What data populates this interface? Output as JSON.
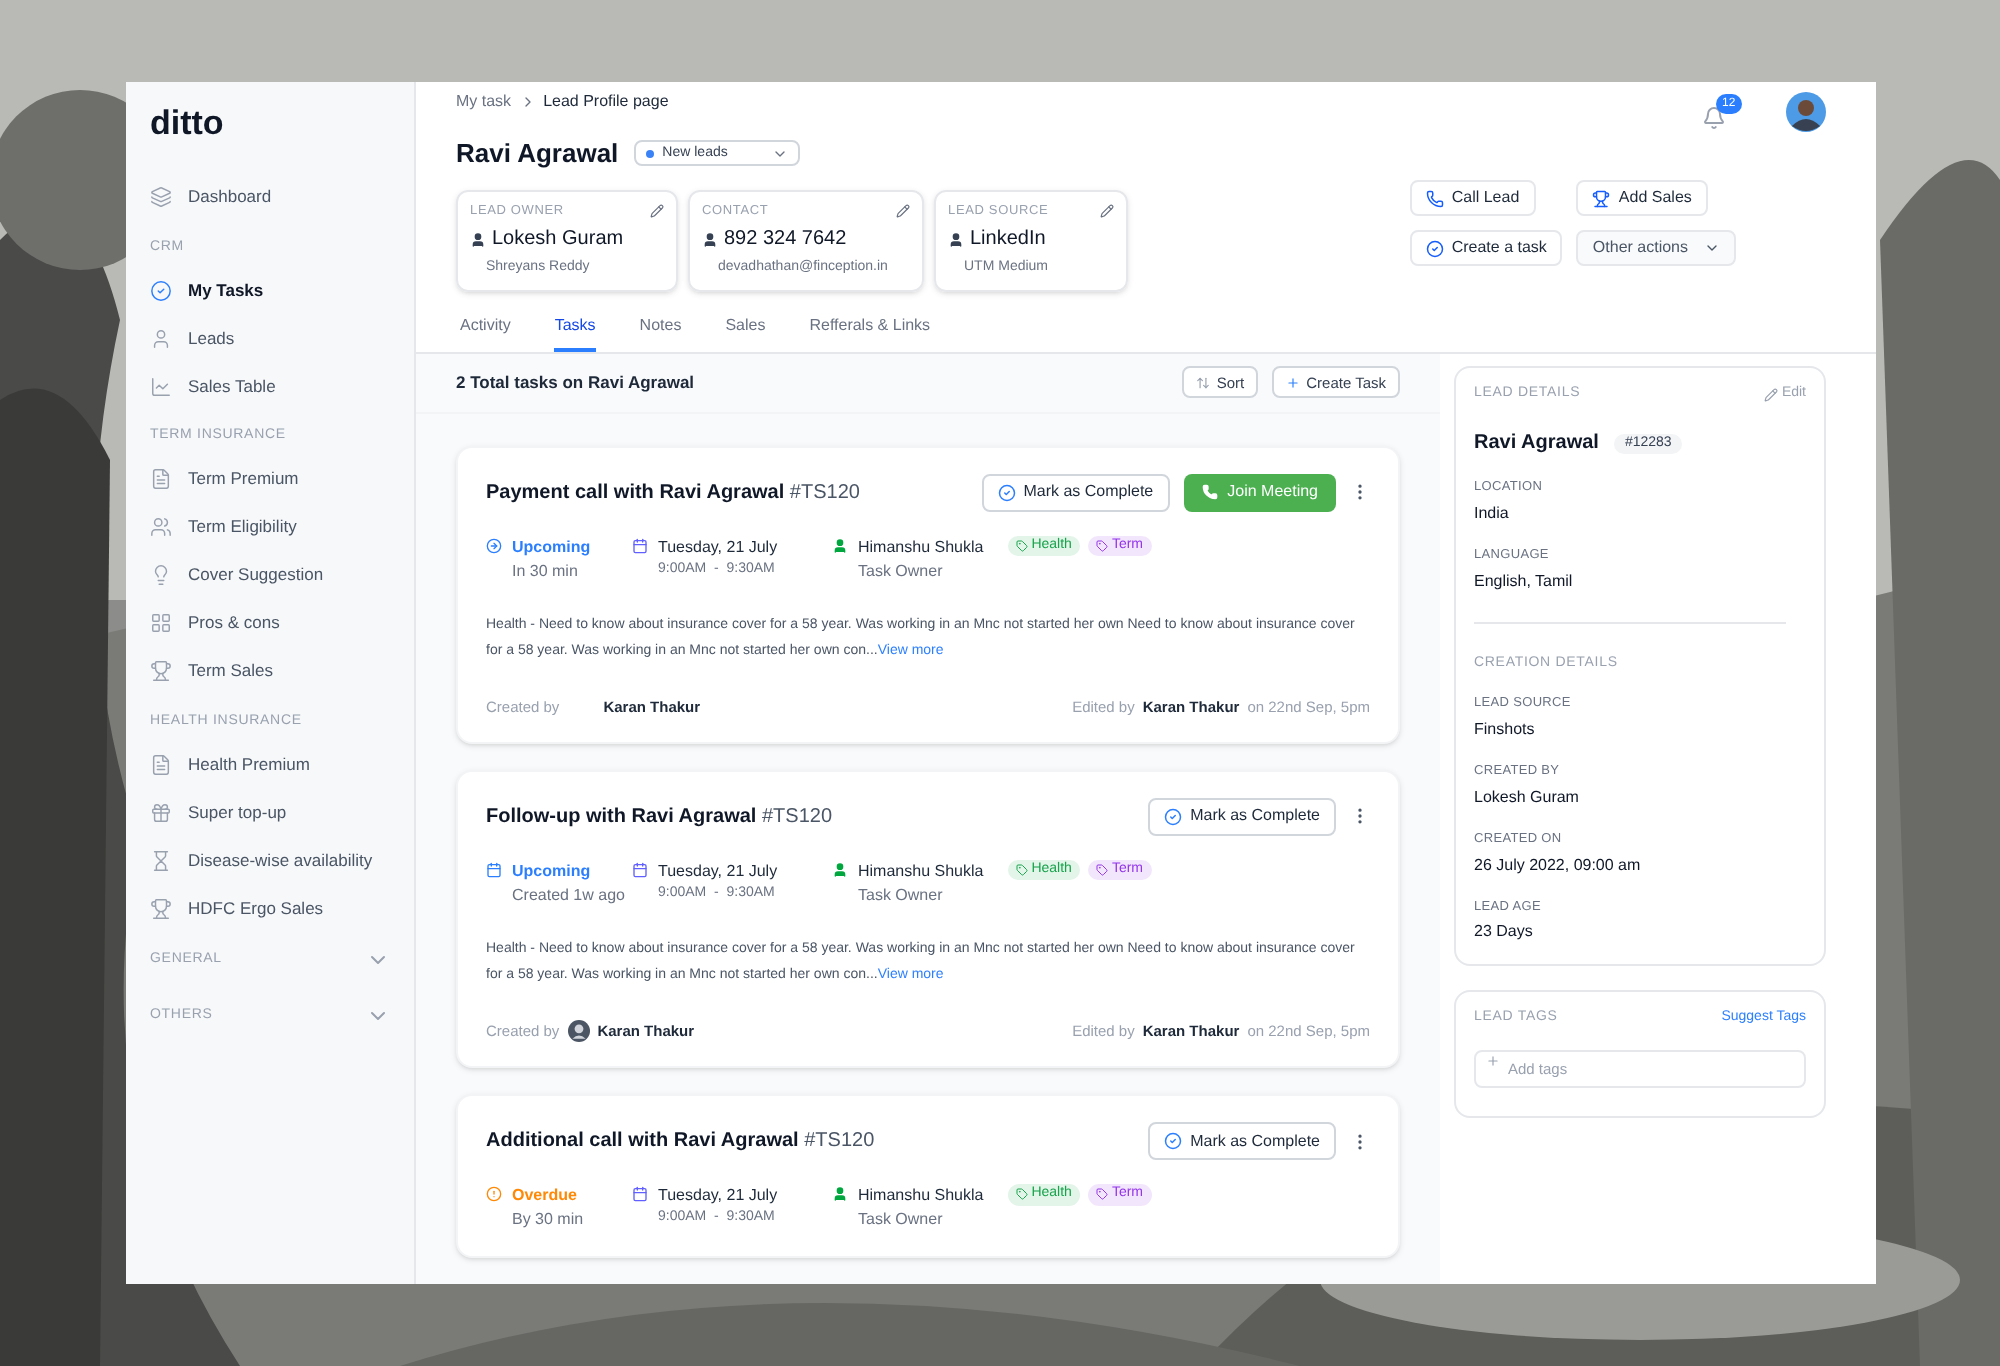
{
  "sidebar": {
    "logo": "ditto",
    "items": [
      {
        "kind": "item",
        "label": "Dashboard",
        "selected": false
      },
      {
        "kind": "section",
        "label": "CRM"
      },
      {
        "kind": "item",
        "label": "My Tasks",
        "selected": true
      },
      {
        "kind": "item",
        "label": "Leads",
        "selected": false
      },
      {
        "kind": "item",
        "label": "Sales Table",
        "selected": false
      },
      {
        "kind": "section",
        "label": "TERM INSURANCE"
      },
      {
        "kind": "item",
        "label": "Term Premium",
        "selected": false
      },
      {
        "kind": "item",
        "label": "Term Eligibility",
        "selected": false
      },
      {
        "kind": "item",
        "label": "Cover Suggestion",
        "selected": false
      },
      {
        "kind": "item",
        "label": "Pros & cons",
        "selected": false
      },
      {
        "kind": "item",
        "label": "Term Sales",
        "selected": false
      },
      {
        "kind": "section",
        "label": "HEALTH INSURANCE"
      },
      {
        "kind": "item",
        "label": "Health Premium",
        "selected": false
      },
      {
        "kind": "item",
        "label": "Super top-up",
        "selected": false
      },
      {
        "kind": "item",
        "label": "Disease-wise availability",
        "selected": false
      },
      {
        "kind": "item",
        "label": "HDFC Ergo Sales",
        "selected": false
      },
      {
        "kind": "group",
        "label": "GENERAL",
        "expanded": false
      },
      {
        "kind": "group",
        "label": "OTHERS",
        "expanded": false
      }
    ]
  },
  "breadcrumb": [
    "My task",
    "Lead Profile page"
  ],
  "notifications": {
    "count": "12"
  },
  "lead": {
    "name": "Ravi Agrawal",
    "status": {
      "label": "New leads",
      "color": "#3b82f6"
    }
  },
  "info_cards": [
    {
      "label": "LEAD OWNER",
      "value": "Lokesh Guram",
      "sub": "Shreyans Reddy"
    },
    {
      "label": "CONTACT",
      "value": "892 324 7642",
      "sub": "devadhathan@finception.in"
    },
    {
      "label": "LEAD SOURCE",
      "value": "LinkedIn",
      "sub": "UTM Medium"
    }
  ],
  "actions": [
    {
      "kind": "call",
      "label": "Call Lead"
    },
    {
      "kind": "sales",
      "label": "Add Sales"
    },
    {
      "kind": "task",
      "label": "Create a task"
    },
    {
      "kind": "menu",
      "label": "Other actions"
    }
  ],
  "tabs": [
    {
      "label": "Activity",
      "selected": false
    },
    {
      "label": "Tasks",
      "selected": true
    },
    {
      "label": "Notes",
      "selected": false
    },
    {
      "label": "Sales",
      "selected": false
    },
    {
      "label": "Refferals & Links",
      "selected": false
    }
  ],
  "tasks_header": {
    "title": "2 Total tasks on Ravi Agrawal",
    "sort": "Sort",
    "create": "Create Task"
  },
  "tasks": [
    {
      "title": "Payment call with Ravi Agrawal",
      "code": "#TS120",
      "complete": "Mark as Complete",
      "join": "Join Meeting",
      "status": {
        "kind": "upcoming",
        "label": "Upcoming",
        "sub": "In 30 min"
      },
      "date": "Tuesday, 21 July",
      "time": "9:00AM  -  9:30AM",
      "owner": "Himanshu Shukla",
      "owner_role": "Task Owner",
      "tags": [
        {
          "label": "Health",
          "color": "#16a34a"
        },
        {
          "label": "Term",
          "color": "#9333ea"
        }
      ],
      "description": "Health - Need to know about insurance cover for a 58 year. Was working in an Mnc not started her own Need to know about insurance cover for a 58 year. Was working in an Mnc not started her own con...",
      "view_more": "View more",
      "created_label": "Created by",
      "created_by": "Karan Thakur",
      "created_avatar": false,
      "edited_label": "Edited by",
      "edited_by": "Karan Thakur",
      "edited_on": "on 22nd Sep, 5pm"
    },
    {
      "title": "Follow-up  with Ravi Agrawal",
      "code": "#TS120",
      "complete": "Mark as Complete",
      "status": {
        "kind": "scheduled",
        "label": "Upcoming",
        "sub": "Created 1w ago"
      },
      "date": "Tuesday, 21 July",
      "time": "9:00AM  -  9:30AM",
      "owner": "Himanshu Shukla",
      "owner_role": "Task Owner",
      "tags": [
        {
          "label": "Health",
          "color": "#16a34a"
        },
        {
          "label": "Term",
          "color": "#9333ea"
        }
      ],
      "description": "Health - Need to know about insurance cover for a 58 year. Was working in an Mnc not started her own Need to know about insurance cover for a 58 year. Was working in an Mnc not started her own con...",
      "view_more": "View more",
      "created_label": "Created by",
      "created_by": "Karan Thakur",
      "created_avatar": true,
      "edited_label": "Edited by",
      "edited_by": "Karan Thakur",
      "edited_on": "on 22nd Sep, 5pm"
    },
    {
      "title": "Additional call with Ravi Agrawal",
      "code": "#TS120",
      "complete": "Mark as Complete",
      "status": {
        "kind": "overdue",
        "label": "Overdue",
        "sub": "By 30 min"
      },
      "date": "Tuesday, 21 July",
      "time": "9:00AM  -  9:30AM",
      "owner": "Himanshu Shukla",
      "owner_role": "Task Owner",
      "tags": [
        {
          "label": "Health",
          "color": "#16a34a"
        },
        {
          "label": "Term",
          "color": "#9333ea"
        }
      ]
    }
  ],
  "lead_details": {
    "title": "LEAD DETAILS",
    "edit": "Edit",
    "name": "Ravi Agrawal",
    "id": "#12283",
    "fields": [
      {
        "label": "LOCATION",
        "value": "India"
      },
      {
        "label": "LANGUAGE",
        "value": "English, Tamil"
      }
    ],
    "creation_title": "CREATION DETAILS",
    "creation_fields": [
      {
        "label": "LEAD SOURCE",
        "value": "Finshots"
      },
      {
        "label": "CREATED BY",
        "value": "Lokesh Guram"
      },
      {
        "label": "CREATED ON",
        "value": "26 July 2022, 09:00 am"
      },
      {
        "label": "LEAD AGE",
        "value": "23 Days"
      }
    ]
  },
  "lead_tags": {
    "title": "LEAD TAGS",
    "suggest": "Suggest Tags",
    "placeholder": "Add tags"
  }
}
